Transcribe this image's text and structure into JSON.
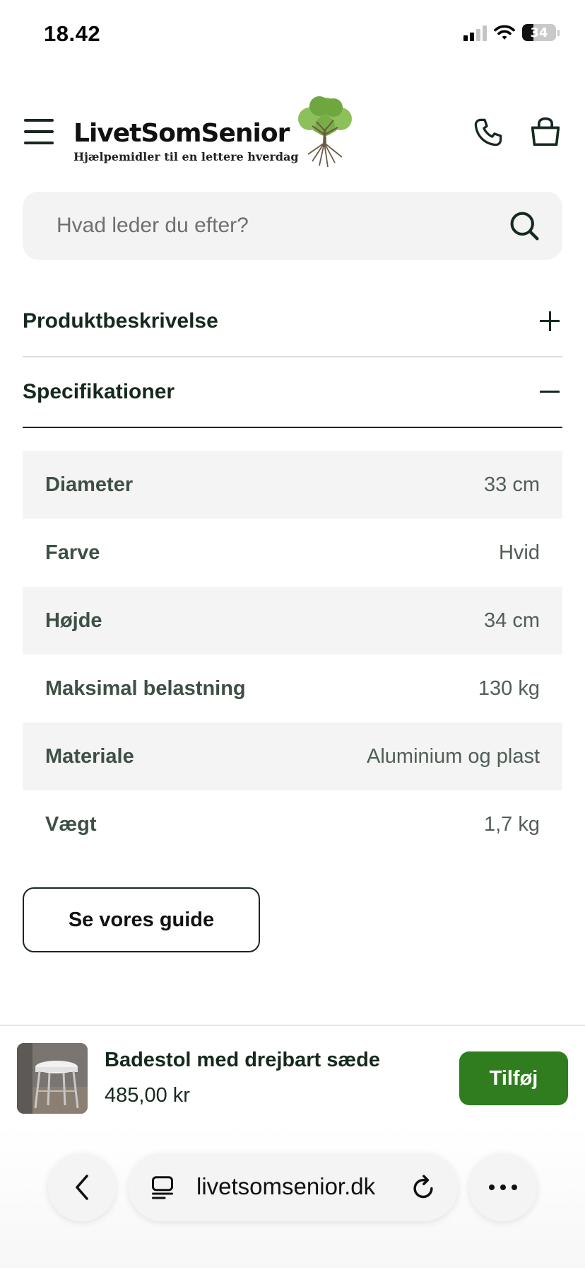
{
  "status_bar": {
    "time": "18.42",
    "battery": "34",
    "battery_level": 0.34
  },
  "header": {
    "logo_name": "LivetSomSenior",
    "logo_tagline": "Hjælpemidler til en lettere hverdag",
    "logo_icon": "tree-logo-icon",
    "menu_icon": "hamburger-menu-icon",
    "phone_icon": "phone-icon",
    "cart_icon": "shopping-bag-icon"
  },
  "search": {
    "placeholder": "Hvad leder du efter?",
    "value": "",
    "icon": "search-icon"
  },
  "accordions": [
    {
      "title": "Produktbeskrivelse",
      "expanded": false,
      "icon": "plus-icon"
    },
    {
      "title": "Specifikationer",
      "expanded": true,
      "icon": "minus-icon"
    }
  ],
  "specs": [
    {
      "label": "Diameter",
      "value": "33 cm"
    },
    {
      "label": "Farve",
      "value": "Hvid"
    },
    {
      "label": "Højde",
      "value": "34 cm"
    },
    {
      "label": "Maksimal belastning",
      "value": "130 kg"
    },
    {
      "label": "Materiale",
      "value": "Aluminium og plast"
    },
    {
      "label": "Vægt",
      "value": "1,7 kg"
    }
  ],
  "guide_button": {
    "label": "Se vores guide"
  },
  "sticky_product": {
    "name": "Badestol med drejbart sæde",
    "price": "485,00 kr",
    "add_label": "Tilføj"
  },
  "browser": {
    "url": "livetsomsenior.dk",
    "back_icon": "chevron-left-icon",
    "reader_icon": "reader-mode-icon",
    "reload_icon": "reload-icon",
    "more_icon": "more-dots-icon"
  },
  "colors": {
    "brand_dark": "#16291d",
    "accent_green": "#2f7d1f",
    "row_shade": "#f4f4f4",
    "search_bg": "#f3f3f3"
  }
}
